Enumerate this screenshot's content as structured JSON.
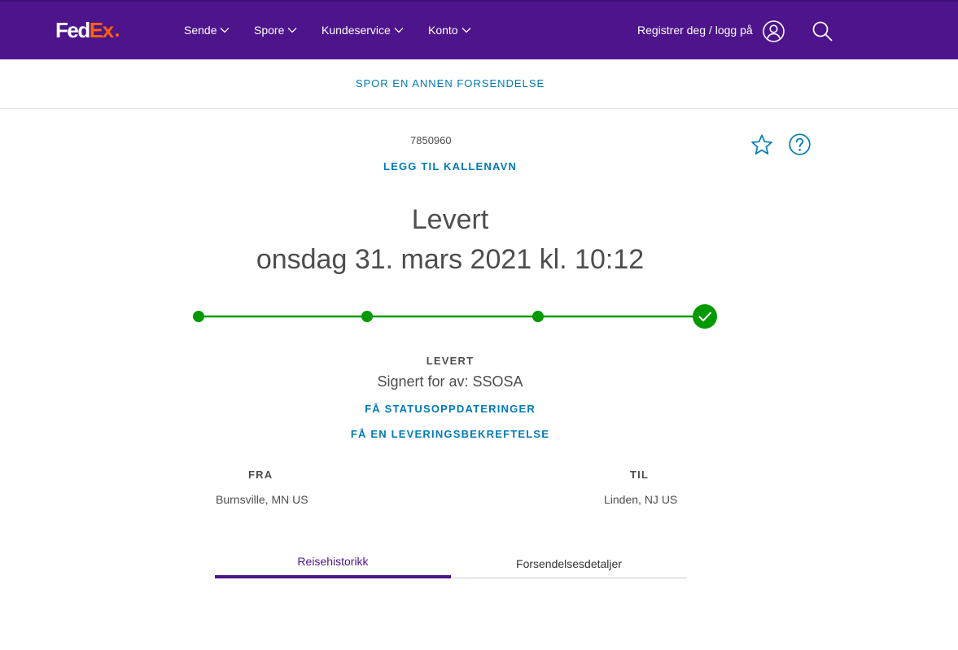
{
  "header": {
    "logo_fed": "Fed",
    "logo_ex": "Ex",
    "nav": [
      {
        "label": "Sende"
      },
      {
        "label": "Spore"
      },
      {
        "label": "Kundeservice"
      },
      {
        "label": "Konto"
      }
    ],
    "login_label": "Registrer deg / logg på",
    "brand_color": "#4d148c",
    "accent_color": "#ff6200"
  },
  "subbar": {
    "track_another": "SPOR EN ANNEN FORSENDELSE"
  },
  "shipment": {
    "tracking_number": "7850960",
    "add_nickname": "LEGG TIL KALLENAVN",
    "status": "Levert",
    "delivered_date": "onsdag 31. mars 2021 kl. 10:12",
    "progress": {
      "steps_total": 4,
      "steps_completed": 4,
      "color": "#009a00"
    },
    "status_label": "LEVERT",
    "signed_by": "Signert for av: SSOSA",
    "get_status_updates": "FÅ STATUSOPPDATERINGER",
    "get_delivery_confirmation": "FÅ EN LEVERINGSBEKREFTELSE",
    "from_label": "FRA",
    "from_value": "Burnsville, MN US",
    "to_label": "TIL",
    "to_value": "Linden, NJ US"
  },
  "tabs": [
    {
      "label": "Reisehistorikk",
      "active": true
    },
    {
      "label": "Forsendelsesdetaljer",
      "active": false
    }
  ],
  "icons": [
    "user-icon",
    "search-icon",
    "star-icon",
    "help-icon",
    "checkmark-icon",
    "chevron-down-icon"
  ],
  "link_color": "#007ab7"
}
